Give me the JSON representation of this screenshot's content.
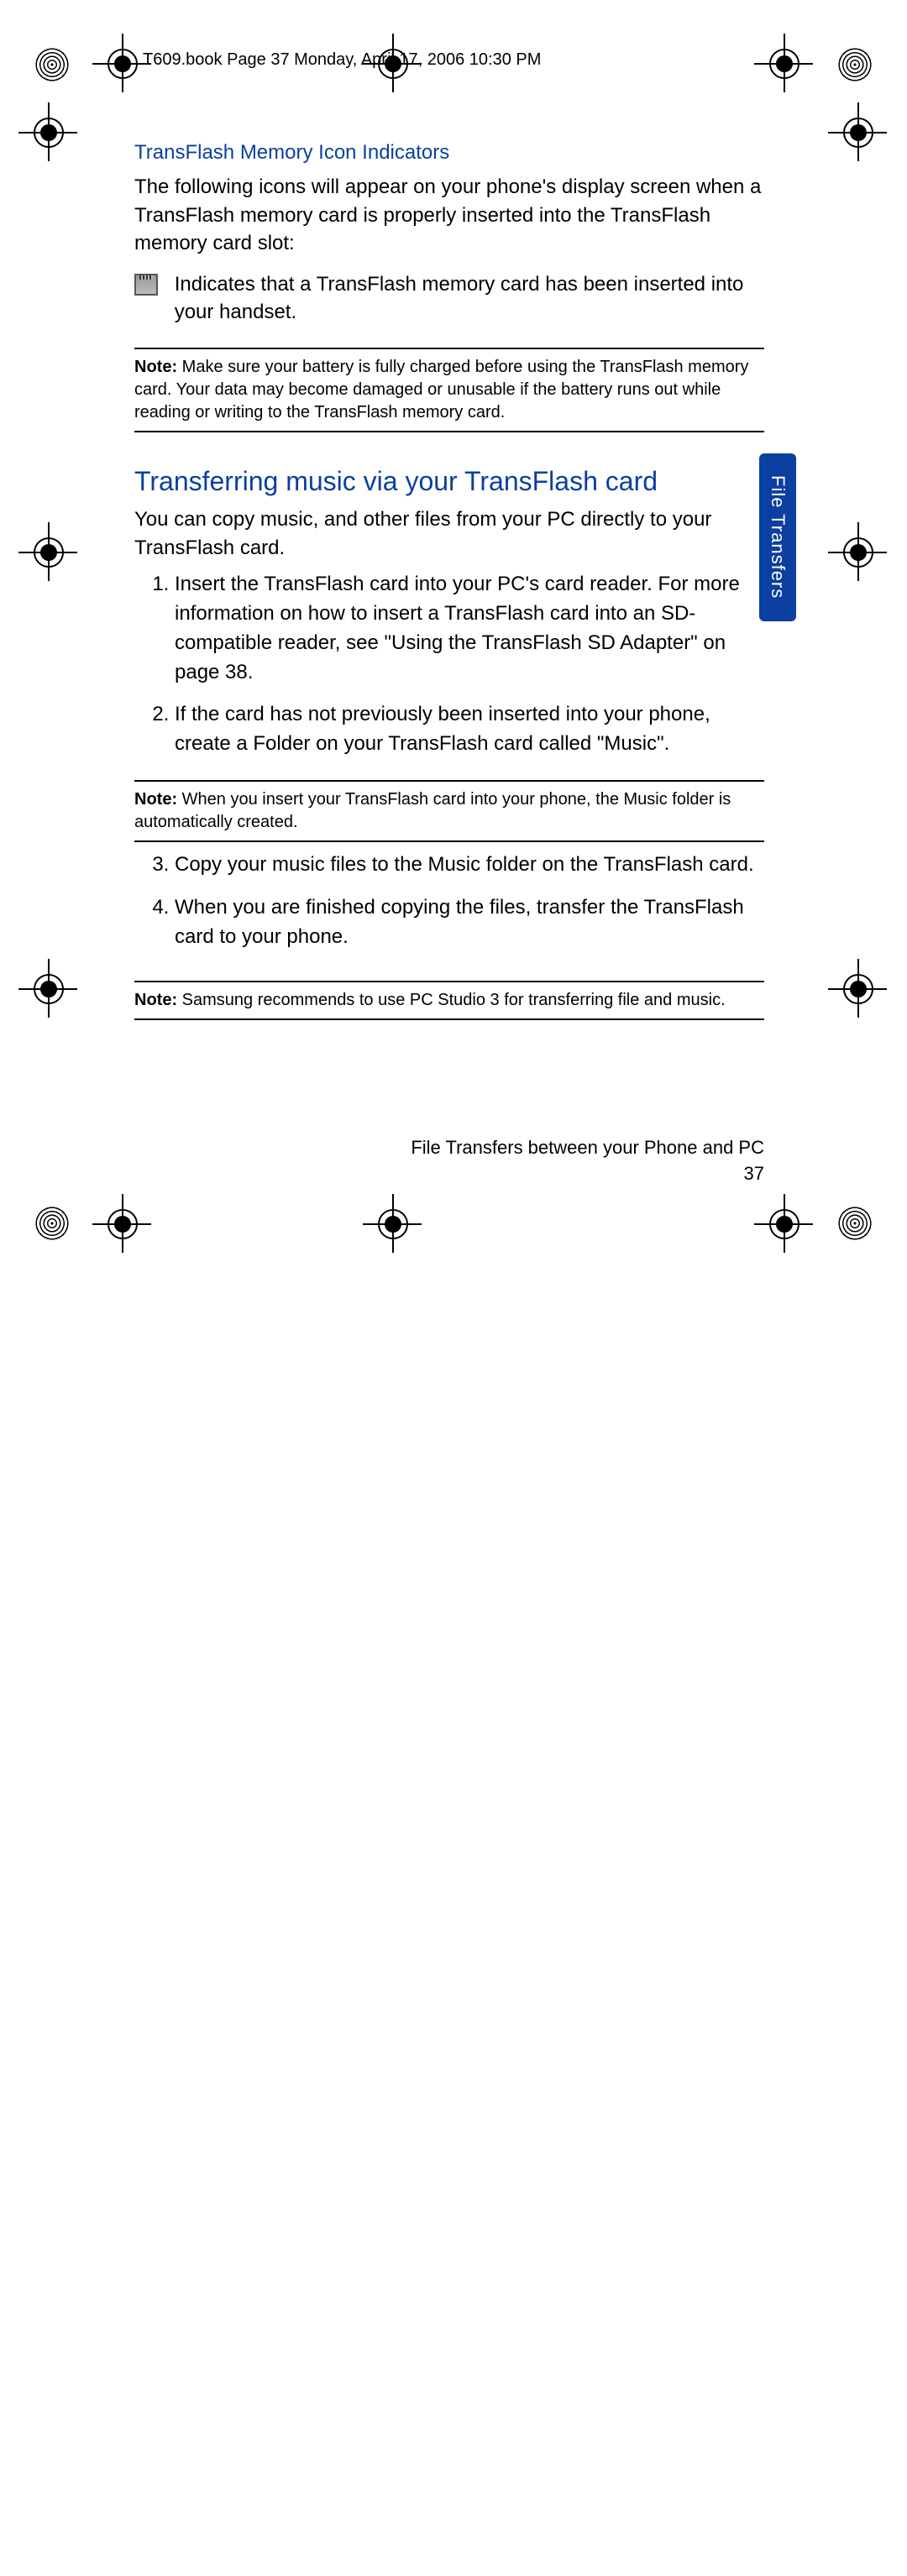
{
  "header": {
    "line": "T609.book  Page 37  Monday, April 17, 2006  10:30 PM"
  },
  "section1": {
    "title": "TransFlash Memory Icon Indicators",
    "intro": "The following icons will appear on your phone's display screen when a TransFlash memory card is properly inserted into the TransFlash memory card slot:",
    "icon_desc": "Indicates that a TransFlash memory card has been inserted into your handset."
  },
  "note1": {
    "label": "Note:",
    "text": " Make sure your battery is fully charged before using the TransFlash memory card. Your data may become damaged or unusable if the battery runs out while reading or writing to the TransFlash memory card."
  },
  "section2": {
    "title": "Transferring music via your TransFlash card",
    "intro": "You can copy music, and other files from your PC directly to your TransFlash card.",
    "steps": [
      "Insert the TransFlash card into your PC's card reader. For more information on how to insert a TransFlash card into an SD-compatible reader, see \"Using the TransFlash SD Adapter\" on page 38.",
      "If the card has not previously been inserted into your phone, create a Folder on your TransFlash card called \"Music\"."
    ]
  },
  "note2": {
    "label": "Note:",
    "text": " When you insert your TransFlash card into your phone, the Music folder is automatically created."
  },
  "section3": {
    "steps": [
      "Copy your music files to the Music folder on the TransFlash card.",
      "When you are finished copying the files, transfer the TransFlash card to your phone."
    ]
  },
  "note3": {
    "label": "Note:",
    "text": " Samsung recommends to use PC Studio 3 for transferring file and music."
  },
  "tab": "File Transfers",
  "footer": {
    "line1": "File Transfers between your Phone and PC",
    "line2": "37"
  }
}
